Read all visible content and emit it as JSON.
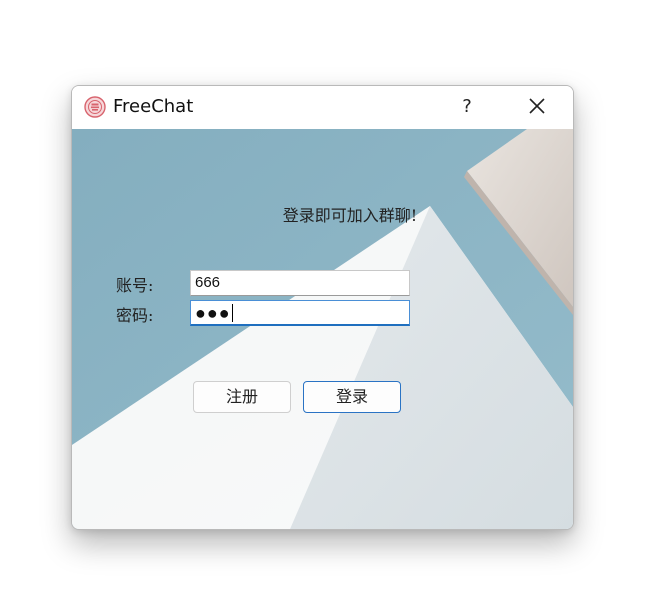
{
  "window": {
    "title": "FreeChat",
    "help_label": "?",
    "icons": {
      "app": "freechat-logo-icon",
      "close": "close-icon"
    }
  },
  "form": {
    "prompt": "登录即可加入群聊!",
    "account_label": "账号:",
    "account_value": "666",
    "password_label": "密码:",
    "password_value": "●●●",
    "register_label": "注册",
    "login_label": "登录"
  },
  "colors": {
    "sky": "#8fb7c7",
    "accent": "#2a73c4"
  }
}
